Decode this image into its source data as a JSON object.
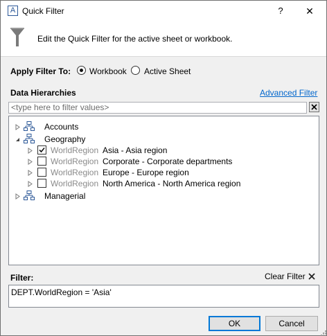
{
  "window": {
    "title": "Quick Filter",
    "app_icon_letter": "A",
    "help_glyph": "?",
    "close_glyph": "✕"
  },
  "header": {
    "description": "Edit the Quick Filter for the active sheet or workbook."
  },
  "apply_filter": {
    "label": "Apply Filter To:",
    "options": [
      {
        "label": "Workbook",
        "selected": true
      },
      {
        "label": "Active Sheet",
        "selected": false
      }
    ]
  },
  "data_hierarchies": {
    "label": "Data Hierarchies",
    "advanced_link": "Advanced Filter",
    "search_placeholder": "<type here to filter values>",
    "tree": [
      {
        "label": "Accounts",
        "expanded": false
      },
      {
        "label": "Geography",
        "expanded": true,
        "children": [
          {
            "level": "WorldRegion",
            "label": "Asia - Asia region",
            "checked": true
          },
          {
            "level": "WorldRegion",
            "label": "Corporate - Corporate departments",
            "checked": false
          },
          {
            "level": "WorldRegion",
            "label": "Europe - Europe region",
            "checked": false
          },
          {
            "level": "WorldRegion",
            "label": "North America - North America region",
            "checked": false
          }
        ]
      },
      {
        "label": "Managerial",
        "expanded": false
      }
    ]
  },
  "filter": {
    "label": "Filter:",
    "clear_label": "Clear Filter",
    "expression": "DEPT.WorldRegion = 'Asia'"
  },
  "buttons": {
    "ok": "OK",
    "cancel": "Cancel"
  },
  "colors": {
    "link": "#0066cc",
    "dialog_bg": "#f0f0f0",
    "hierarchy_icon": "#2b5797",
    "accent_border": "#0078d7"
  }
}
